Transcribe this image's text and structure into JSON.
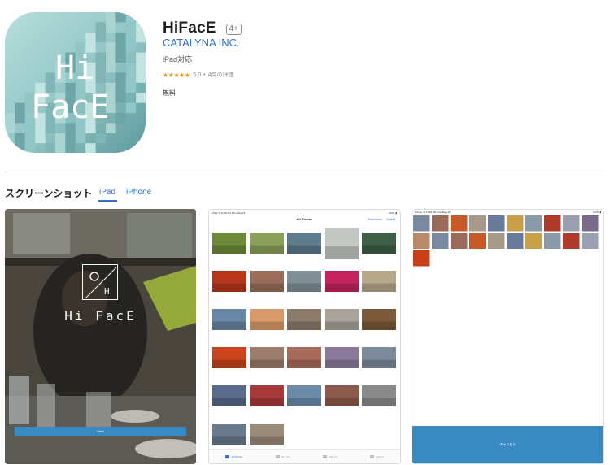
{
  "app": {
    "title": "HiFacE",
    "age_rating": "4+",
    "developer": "CATALYNA INC.",
    "compatibility": "iPad対応",
    "rating_value": "5.0",
    "rating_count": "4件の評価",
    "price": "無料",
    "icon_text_line1": "Hi",
    "icon_text_line2": "FacE"
  },
  "screenshots": {
    "section_title": "スクリーンショット",
    "tabs": [
      "iPad",
      "iPhone"
    ],
    "active_tab": "iPad",
    "shot1": {
      "logo_letter": "H",
      "title": "Hi FacE",
      "start_label": "Start"
    },
    "shot2": {
      "status_left": "iPad ᯤ  11:18 AM  Mon May 25",
      "status_right": "100% ▮",
      "nav_title": "All Photos",
      "nav_links": [
        "Slideshow",
        "Select"
      ],
      "tabs": [
        "All Photos",
        "For You",
        "Albums",
        "Search"
      ],
      "active_tab": "All Photos"
    },
    "shot3": {
      "status_left": "iPhone ᯤ  11:18 AM  Mon May 25",
      "status_right": "100% ▮",
      "bottom_label": "キャンセル"
    }
  },
  "colors": {
    "link": "#2f6fd0",
    "star": "#f2941a",
    "accent_button": "#3a8ac2",
    "icon_bg": "#9ccbcc"
  }
}
